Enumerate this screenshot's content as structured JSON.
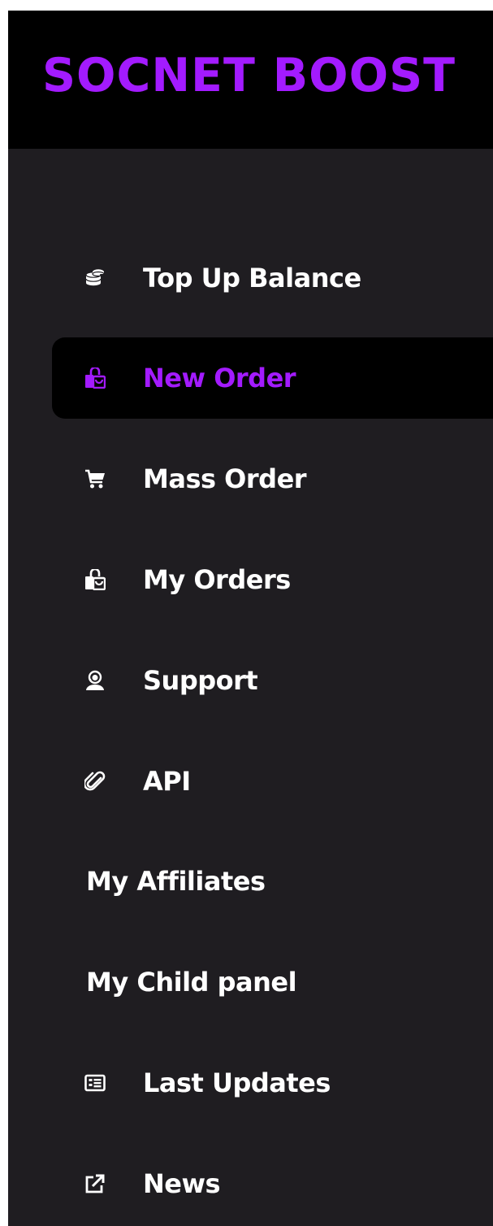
{
  "brand": {
    "name": "SOCNET BOOST",
    "color": "#a31bff"
  },
  "theme": {
    "sidebar_bg": "#1f1d21",
    "header_bg": "#000000",
    "active_bg": "#000000",
    "text": "#ffffff",
    "accent": "#a31bff"
  },
  "sidebar": {
    "items": [
      {
        "label": "Top Up Balance",
        "icon": "coins-icon",
        "active": false
      },
      {
        "label": "New Order",
        "icon": "shopping-bag-icon",
        "active": true
      },
      {
        "label": "Mass Order",
        "icon": "cart-icon",
        "active": false
      },
      {
        "label": "My Orders",
        "icon": "shopping-bag-icon",
        "active": false
      },
      {
        "label": "Support",
        "icon": "support-agent-icon",
        "active": false
      },
      {
        "label": "API",
        "icon": "paperclip-icon",
        "active": false
      },
      {
        "label": "My Affiliates",
        "icon": "",
        "active": false
      },
      {
        "label": "My Child panel",
        "icon": "",
        "active": false
      },
      {
        "label": "Last Updates",
        "icon": "newspaper-icon",
        "active": false
      },
      {
        "label": "News",
        "icon": "external-link-icon",
        "active": false
      }
    ]
  }
}
